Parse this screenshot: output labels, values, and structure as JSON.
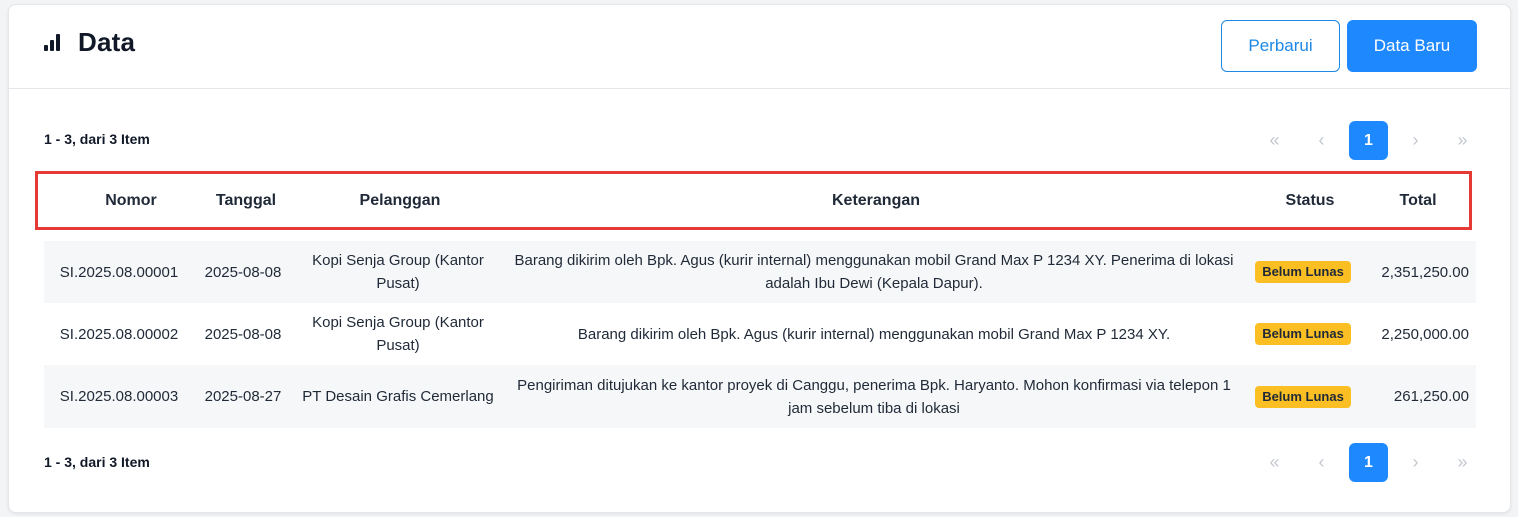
{
  "header": {
    "title": "Data",
    "refresh_label": "Perbarui",
    "new_label": "Data Baru"
  },
  "summary": "1 - 3, dari 3 Item",
  "pagination": {
    "first": "«",
    "prev": "‹",
    "current": "1",
    "next": "›",
    "last": "»"
  },
  "table": {
    "columns": [
      "Nomor",
      "Tanggal",
      "Pelanggan",
      "Keterangan",
      "Status",
      "Total"
    ],
    "rows": [
      {
        "nomor": "SI.2025.08.00001",
        "tanggal": "2025-08-08",
        "pelanggan": "Kopi Senja Group (Kantor Pusat)",
        "keterangan": "Barang dikirim oleh Bpk. Agus (kurir internal) menggunakan mobil Grand Max P 1234 XY. Penerima di lokasi adalah Ibu Dewi (Kepala Dapur).",
        "status": "Belum Lunas",
        "total": "2,351,250.00"
      },
      {
        "nomor": "SI.2025.08.00002",
        "tanggal": "2025-08-08",
        "pelanggan": "Kopi Senja Group (Kantor Pusat)",
        "keterangan": "Barang dikirim oleh Bpk. Agus (kurir internal) menggunakan mobil Grand Max P 1234 XY.",
        "status": "Belum Lunas",
        "total": "2,250,000.00"
      },
      {
        "nomor": "SI.2025.08.00003",
        "tanggal": "2025-08-27",
        "pelanggan": "PT Desain Grafis Cemerlang",
        "keterangan": "Pengiriman ditujukan ke kantor proyek di Canggu, penerima Bpk. Haryanto. Mohon konfirmasi via telepon 1 jam sebelum tiba di lokasi",
        "status": "Belum Lunas",
        "total": "261,250.00"
      }
    ]
  },
  "colors": {
    "primary": "#1e88ff",
    "highlight_border": "#e53935",
    "status_badge": "#fbbf24"
  },
  "icons": {
    "title_icon": "bar-chart-icon"
  }
}
